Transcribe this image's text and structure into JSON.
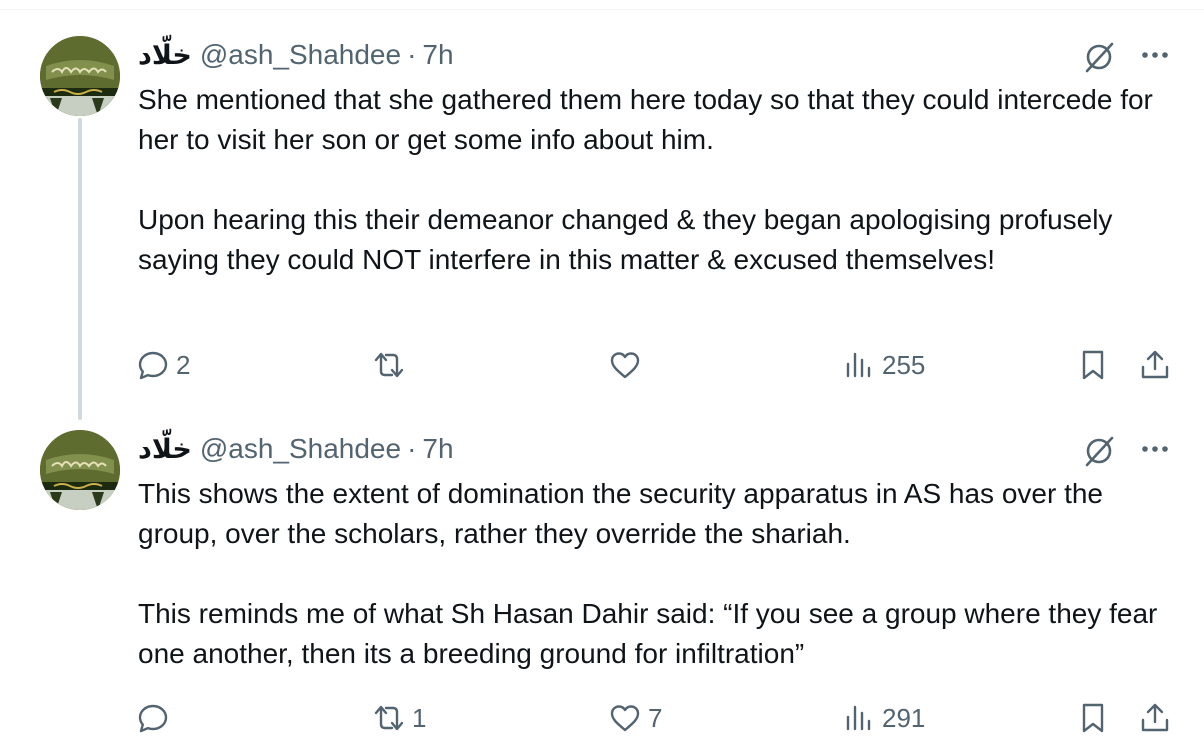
{
  "tweets": [
    {
      "display_name": "خلّاد",
      "handle": "@ash_Shahdee",
      "separator": "·",
      "time": "7h",
      "paragraphs": [
        "She mentioned that she gathered them here today so that they could intercede for her to visit her son or get some info about him.",
        "Upon hearing this their demeanor changed & they began apologising profusely saying they could NOT interfere in this matter & excused themselves!"
      ],
      "replies": "2",
      "retweets": "",
      "likes": "",
      "views": "255"
    },
    {
      "display_name": "خلّاد",
      "handle": "@ash_Shahdee",
      "separator": "·",
      "time": "7h",
      "paragraphs": [
        "This shows the extent of domination the security apparatus in AS has over the group, over the scholars, rather they override the shariah.",
        "This reminds me of what Sh Hasan Dahir said: “If you see a group where they fear one another, then its a breeding ground for infiltration”"
      ],
      "replies": "",
      "retweets": "1",
      "likes": "7",
      "views": "291"
    }
  ],
  "icons": {
    "reply": "reply-icon",
    "retweet": "retweet-icon",
    "like": "like-icon",
    "views": "views-icon",
    "bookmark": "bookmark-icon",
    "share": "share-icon",
    "grok": "grok-icon",
    "more": "more-icon"
  },
  "colors": {
    "text": "#0f1419",
    "secondary": "#536471",
    "thread_line": "#cfd9de"
  }
}
